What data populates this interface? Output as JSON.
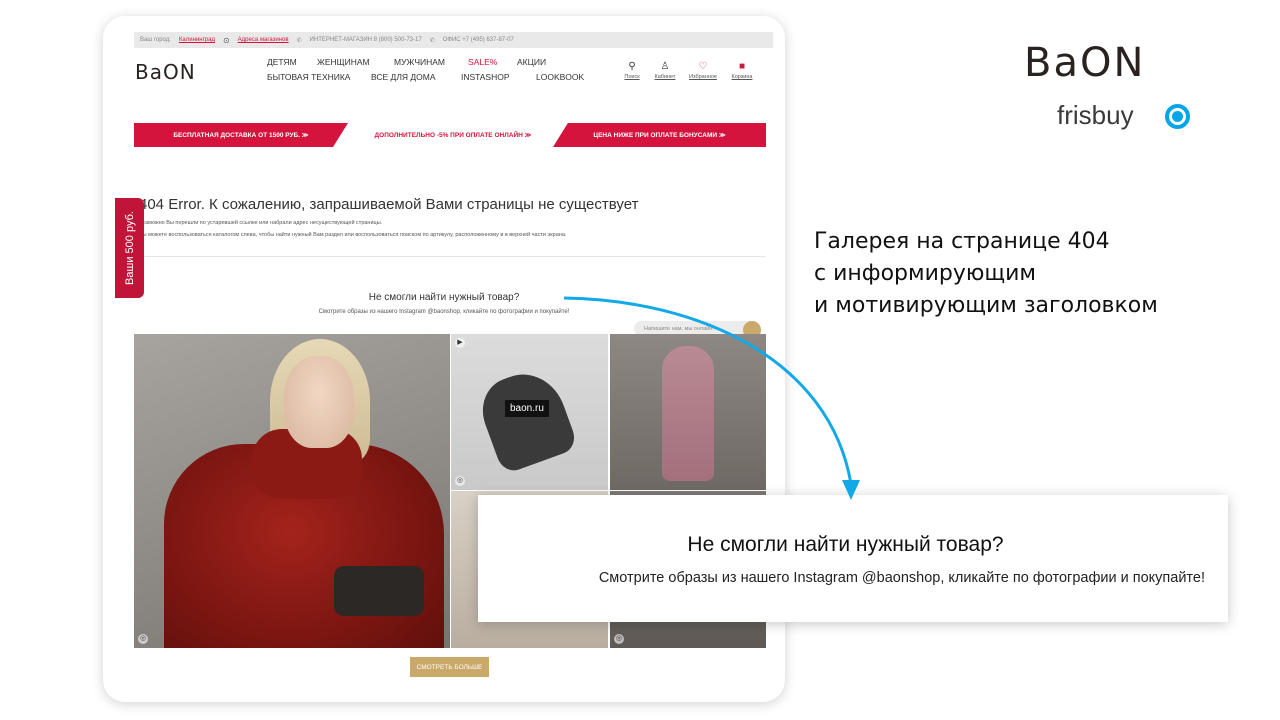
{
  "topbar": {
    "city_label": "Ваш город:",
    "city": "Калининград",
    "stores": "Адреса магазинов",
    "shop_phone": "ИНТЕРНЕТ-МАГАЗИН 8 (800) 500-73-17",
    "office_phone": "ОФИС +7 (495) 637-87-07"
  },
  "site_logo": "BaON",
  "nav": {
    "row1": [
      "ДЕТЯМ",
      "ЖЕНЩИНАМ",
      "МУЖЧИНАМ",
      "SALE%",
      "АКЦИИ"
    ],
    "row2": [
      "БЫТОВАЯ ТЕХНИКА",
      "ВСЕ ДЛЯ ДОМА",
      "INSTASHOP",
      "LOOKBOOK"
    ]
  },
  "header_icons": [
    {
      "icon": "search-icon",
      "label": "Поиск"
    },
    {
      "icon": "user-icon",
      "label": "Кабинет"
    },
    {
      "icon": "heart-icon",
      "label": "Избранное"
    },
    {
      "icon": "bag-icon",
      "label": "Корзина"
    }
  ],
  "promos": {
    "free_delivery": "БЕСПЛАТНАЯ ДОСТАВКА ОТ 1500 РУБ. ≫",
    "online_discount": "ДОПОЛНИТЕЛЬНО -5% ПРИ ОПЛАТЕ ОНЛАЙН ≫",
    "bonus_price": "ЦЕНА НИЖЕ ПРИ ОПЛАТЕ БОНУСАМИ ≫"
  },
  "error": {
    "title": "404 Error. К сожалению, запрашиваемой Вами страницы не существует",
    "line1": "Возможно Вы перешли по устаревшей ссылке или набрали адрес несуществующей страницы.",
    "line2": "Вы можете воспользоваться каталогом слева, чтобы найти нужный Вам раздел или воспользоваться поиском по артикулу, расположенному в в верхней части экрана."
  },
  "gallery": {
    "title": "Не смогли найти нужный товар?",
    "subtitle": "Смотрите образы из нашего Instagram @baonshop, кликайте по фотографии и покупайте!",
    "chat_placeholder": "Напишите нам, мы онлайн!",
    "tile_tag": "baon.ru",
    "more_button": "СМОТРЕТЬ БОЛЬШЕ"
  },
  "side_tab": "Ваши 500 руб.",
  "brand": {
    "logo": "BaON",
    "partner": "frisbuy"
  },
  "caption": [
    "Галерея на странице 404",
    "с информирующим",
    "и мотивирующим заголовком"
  ],
  "callout": {
    "title": "Не смогли найти нужный товар?",
    "subtitle": "Смотрите образы из нашего Instagram @baonshop, кликайте по фотографии и покупайте!"
  },
  "colors": {
    "brand_red": "#d4143c",
    "gold": "#c9a86a",
    "arrow_blue": "#12a9e6"
  }
}
